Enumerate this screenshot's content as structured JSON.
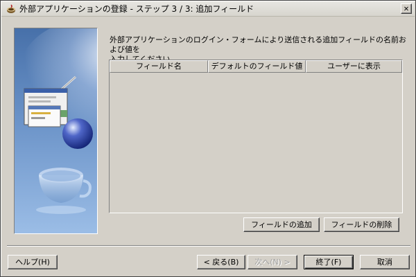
{
  "window": {
    "title": "外部アプリケーションの登録 - ステップ 3 / 3: 追加フィールド",
    "close_label": "✕"
  },
  "instruction": {
    "line1": "外部アプリケーションのログイン・フォームにより送信される追加フィールドの名前および値を",
    "line2": "入力してください"
  },
  "table": {
    "columns": [
      "フィールド名",
      "デフォルトのフィールド値",
      "ユーザーに表示"
    ],
    "rows": []
  },
  "table_actions": {
    "add_field": "フィールドの追加",
    "delete_field": "フィールドの削除"
  },
  "footer": {
    "help": "ヘルプ(H)",
    "back": "< 戻る(B)",
    "next": "次へ(N) >",
    "finish": "終了(F)",
    "cancel": "取消"
  }
}
